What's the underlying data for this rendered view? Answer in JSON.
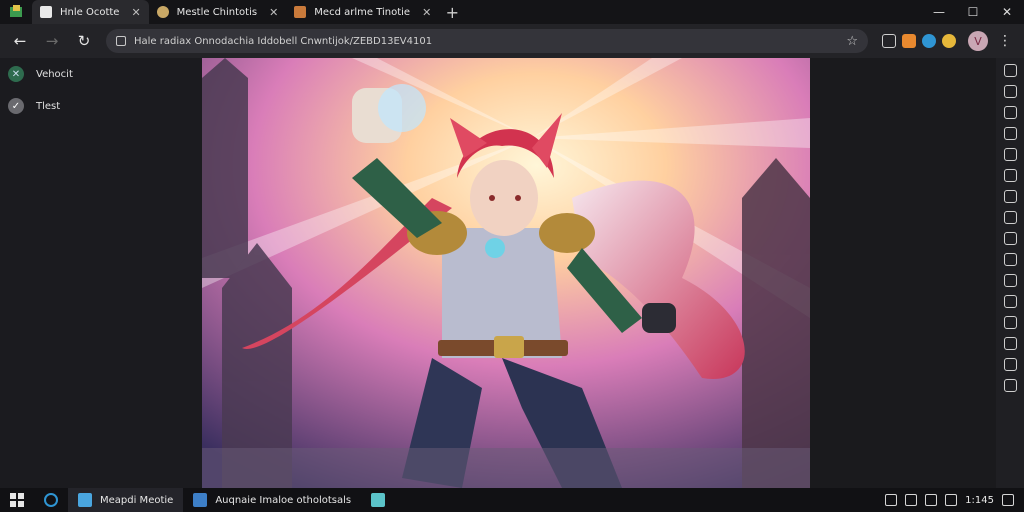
{
  "tabs": [
    {
      "label": "Hnle Ocotte",
      "active": true
    },
    {
      "label": "Mestle Chintotis",
      "active": false
    },
    {
      "label": "Mecd arlme Tinotie",
      "active": false
    }
  ],
  "toolbar": {
    "url": "Hale radiax Onnodachia Iddobell Cnwntijok/ZEBD13EV4101"
  },
  "sidebar": {
    "items": [
      {
        "label": "Vehocit"
      },
      {
        "label": "Tlest"
      }
    ]
  },
  "taskbar": {
    "items": [
      {
        "label": "Meapdi  Meotie"
      },
      {
        "label": "Auqnaie Imaloe otholotsals"
      }
    ],
    "tray_time": "1:145"
  },
  "colors": {
    "accent": "#2f95d3",
    "avatar": "#c9a7b4"
  }
}
